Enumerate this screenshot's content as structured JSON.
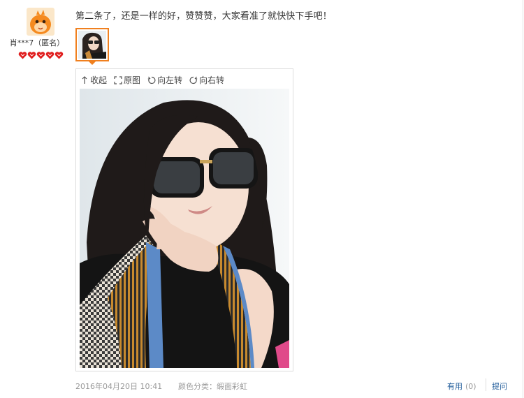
{
  "user": {
    "name": "肖***7（匿名）",
    "level_hearts": 5,
    "avatar_icon": "mascot-avatar-icon"
  },
  "review": {
    "text": "第二条了，还是一样的好，赞赞赞，大家看准了就快快下手吧！",
    "date": "2016年04月20日 10:41",
    "color_label": "颜色分类：缎面彩虹"
  },
  "viewer": {
    "toolbar": {
      "collapse": "收起",
      "original": "原图",
      "rotate_left": "向左转",
      "rotate_right": "向右转"
    }
  },
  "actions": {
    "useful": "有用",
    "useful_count": "(0)",
    "ask": "提问"
  },
  "colors": {
    "accent": "#f0801f",
    "link": "#1f5b9a",
    "muted": "#999999",
    "heart": "#e02020"
  }
}
